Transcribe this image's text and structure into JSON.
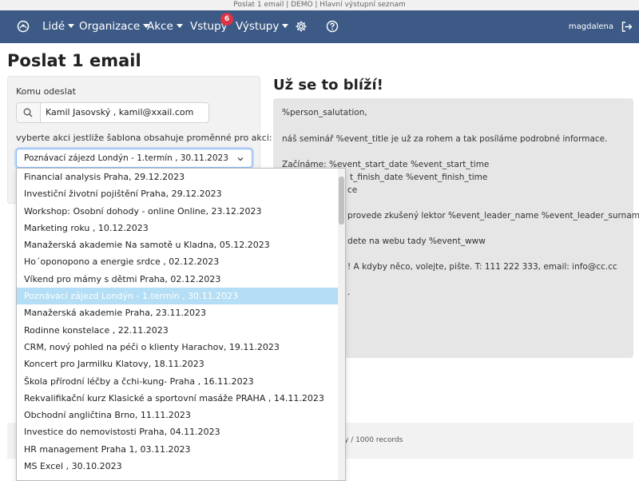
{
  "window": {
    "title": "Poslat 1 email | DEMO | Hlavní výstupní seznam"
  },
  "nav": {
    "items": [
      {
        "label": "Lidé",
        "has_caret": true
      },
      {
        "label": "Organizace",
        "has_caret": true
      },
      {
        "label": "Akce",
        "has_caret": true
      },
      {
        "label": "Vstupy",
        "has_caret": false
      },
      {
        "label": "Výstupy",
        "has_caret": true
      }
    ],
    "badge": "6",
    "user": "magdalena"
  },
  "page": {
    "title": "Poslat 1 email"
  },
  "form": {
    "to_label": "Komu odeslat",
    "recipient": "Kamil Jasovský , kamil@xxail.com",
    "select_label": "vyberte akci jestliže šablona obsahuje proměnné pro akci:",
    "selected": "Poznávací zájezd Londýn - 1.termín , 30.11.2023"
  },
  "dropdown": {
    "options": [
      "Financial analysis Praha, 29.12.2023",
      "Investiční životní pojištění Praha, 29.12.2023",
      "Workshop: Osobní dohody - online Online, 23.12.2023",
      "Marketing roku , 10.12.2023",
      "Manažerská akademie Na samotě u Kladna, 05.12.2023",
      "Ho´oponopono a energie srdce , 02.12.2023",
      "Víkend pro mámy s dětmi Praha, 02.12.2023",
      "Poznávací zájezd Londýn - 1.termín , 30.11.2023",
      "Manažerská akademie Praha, 23.11.2023",
      "Rodinne konstelace , 22.11.2023",
      "CRM, nový pohled na péči o klienty Harachov, 19.11.2023",
      "Koncert pro Jarmilku Klatovy, 18.11.2023",
      "Škola přírodní léčby a čchi-kung- Praha , 16.11.2023",
      "Rekvalifikační kurz Klasické a sportovní masáže PRAHA , 14.11.2023",
      "Obchodní angličtina Brno, 11.11.2023",
      "Investice do nemovistosti Praha, 04.11.2023",
      "HR management Praha 1, 03.11.2023",
      "MS Excel , 30.10.2023"
    ],
    "selected_index": 7
  },
  "template": {
    "title": "Už se to blíží!",
    "lines": [
      "%person_salutation,",
      "náš seminář %event_title je už za rohem a tak posíláme podrobné informace.",
      "Začínáme: %event_start_date %event_start_time",
      "t_finish_date %event_finish_time",
      "ce",
      "provede zkušený lektor %event_leader_name %event_leader_surname",
      "dete na webu tady %event_www",
      "! A kdyby něco, volejte, pište. T: 111 222 333, email: info@cc.cc",
      "."
    ]
  },
  "footer": {
    "records": "ily / 1000 records"
  }
}
